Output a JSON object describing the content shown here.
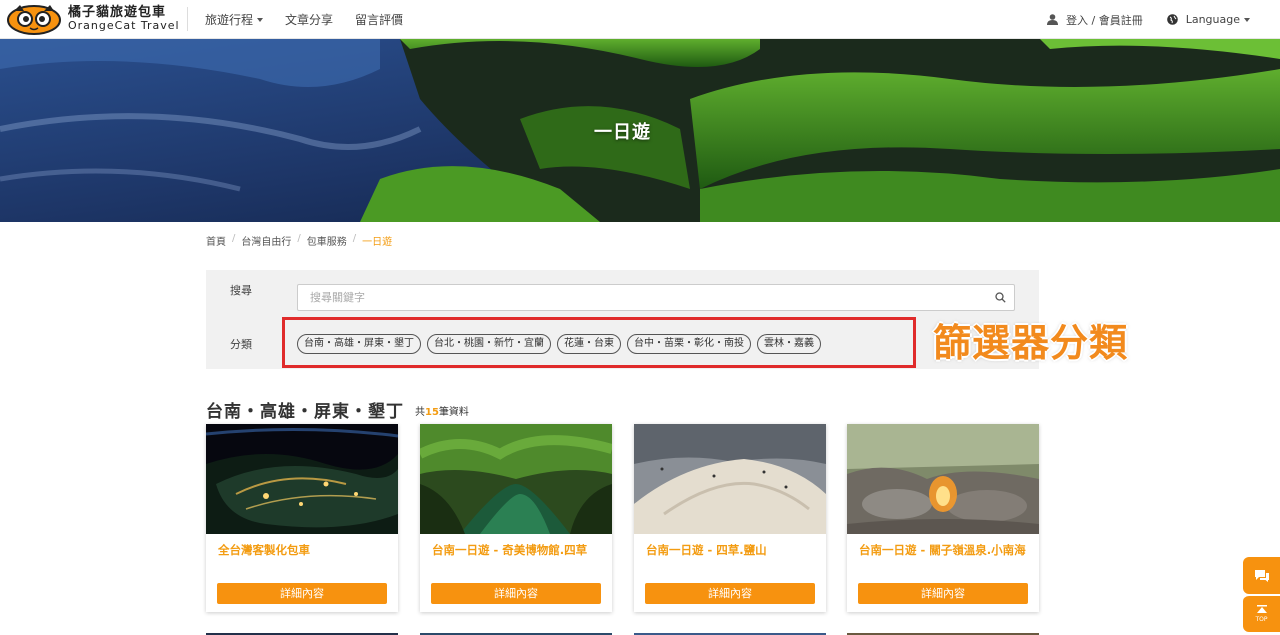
{
  "header": {
    "brand_zh": "橘子貓旅遊包車",
    "brand_en": "OrangeCat Travel",
    "nav": [
      {
        "label": "旅遊行程",
        "has_dropdown": true
      },
      {
        "label": "文章分享",
        "has_dropdown": false
      },
      {
        "label": "留言評價",
        "has_dropdown": false
      }
    ],
    "login_label": "登入 / 會員註冊",
    "language_label": "Language",
    "icons": {
      "user": "user-icon",
      "globe": "globe-icon"
    }
  },
  "banner": {
    "title": "一日遊"
  },
  "breadcrumb": {
    "items": [
      "首頁",
      "台灣自由行",
      "包車服務"
    ],
    "current": "一日遊"
  },
  "filter": {
    "search_label": "搜尋",
    "search_placeholder": "搜尋關鍵字",
    "category_label": "分類",
    "chips": [
      "台南・高雄・屏東・墾丁",
      "台北・桃園・新竹・宜蘭",
      "花蓮・台東",
      "台中・苗栗・彰化・南投",
      "雲林・嘉義"
    ],
    "annotation": "篩選器分類"
  },
  "section": {
    "title": "台南・高雄・屏東・墾丁",
    "count_prefix": "共",
    "count": "15",
    "count_suffix": "筆資料"
  },
  "cards": [
    {
      "title": "全台灣客製化包車",
      "button": "詳細內容"
    },
    {
      "title": "台南一日遊 - 奇美博物館.四草",
      "button": "詳細內容"
    },
    {
      "title": "台南一日遊 - 四草.鹽山",
      "button": "詳細內容"
    },
    {
      "title": "台南一日遊 - 關子嶺溫泉.小南海",
      "button": "詳細內容"
    }
  ],
  "floating": {
    "chat_icon": "chat-icon",
    "top_label": "TOP"
  },
  "colors": {
    "accent": "#f7920f",
    "highlight_box": "#e02b2b"
  }
}
